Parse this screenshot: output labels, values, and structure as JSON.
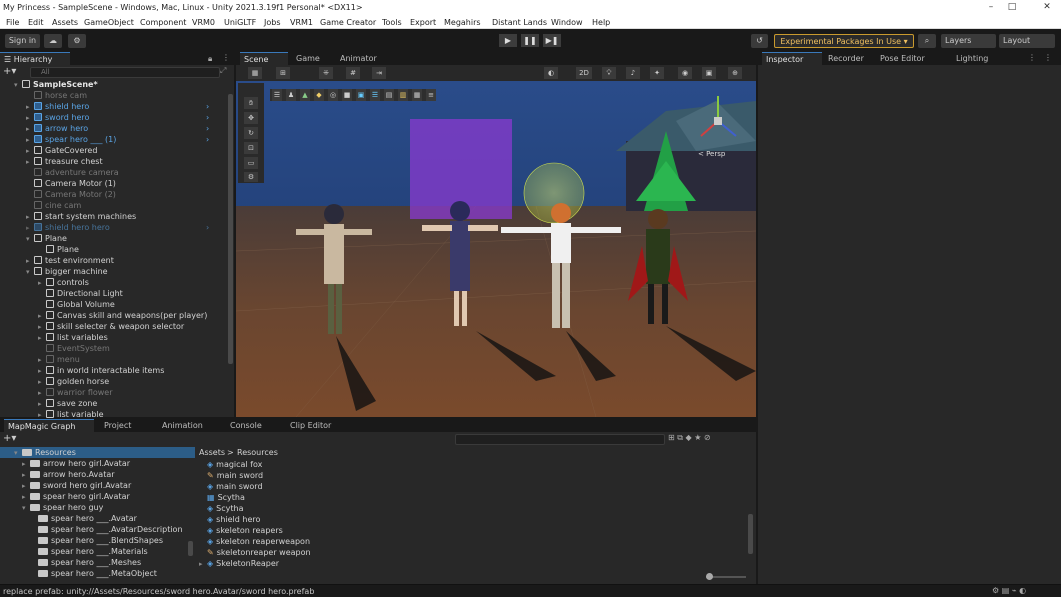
{
  "window": {
    "title": "My Princess - SampleScene - Windows, Mac, Linux - Unity 2021.3.19f1 Personal* <DX11>",
    "minimize": "–",
    "maximize": "□",
    "close": "✕"
  },
  "menu": [
    "File",
    "Edit",
    "Assets",
    "GameObject",
    "Component",
    "VRM0",
    "UniGLTF",
    "Jobs",
    "VRM1",
    "Game Creator",
    "Tools",
    "Export",
    "Megahirs",
    "Distant Lands",
    "Window",
    "Help"
  ],
  "toolbar": {
    "sign_in": "Sign in",
    "play": "▶",
    "pause": "❚❚",
    "step": "▶❚",
    "experimental": "Experimental Packages In Use ▾",
    "layers": "Layers",
    "layout": "Layout"
  },
  "hierarchy": {
    "tab": "Hierarchy",
    "search_placeholder": "All",
    "items": [
      {
        "label": "SampleScene*",
        "style": "scene",
        "indent": 0,
        "arrow": "▾"
      },
      {
        "label": "horse cam",
        "style": "dim",
        "indent": 2,
        "arrow": ""
      },
      {
        "label": "shield hero",
        "style": "blue",
        "indent": 2,
        "arrow": "▸"
      },
      {
        "label": "sword hero",
        "style": "blue",
        "indent": 2,
        "arrow": "▸"
      },
      {
        "label": "arrow hero",
        "style": "blue",
        "indent": 2,
        "arrow": "▸"
      },
      {
        "label": "spear hero ___ (1)",
        "style": "blue",
        "indent": 2,
        "arrow": "▸"
      },
      {
        "label": "GateCovered",
        "style": "normal",
        "indent": 2,
        "arrow": "▸"
      },
      {
        "label": "treasure chest",
        "style": "normal",
        "indent": 2,
        "arrow": "▸"
      },
      {
        "label": "adventure camera",
        "style": "dim",
        "indent": 2,
        "arrow": ""
      },
      {
        "label": "Camera Motor (1)",
        "style": "normal",
        "indent": 2,
        "arrow": ""
      },
      {
        "label": "Camera Motor (2)",
        "style": "dim",
        "indent": 2,
        "arrow": ""
      },
      {
        "label": "cine cam",
        "style": "dim",
        "indent": 2,
        "arrow": ""
      },
      {
        "label": "start system machines",
        "style": "normal",
        "indent": 2,
        "arrow": "▸"
      },
      {
        "label": "shield hero hero",
        "style": "blue-dim",
        "indent": 2,
        "arrow": "▸"
      },
      {
        "label": "Plane",
        "style": "normal",
        "indent": 2,
        "arrow": "▾"
      },
      {
        "label": "Plane",
        "style": "normal",
        "indent": 4,
        "arrow": ""
      },
      {
        "label": "test environment",
        "style": "normal",
        "indent": 2,
        "arrow": "▸"
      },
      {
        "label": "bigger machine",
        "style": "normal",
        "indent": 2,
        "arrow": "▾"
      },
      {
        "label": "controls",
        "style": "normal",
        "indent": 4,
        "arrow": "▸"
      },
      {
        "label": "Directional Light",
        "style": "normal",
        "indent": 4,
        "arrow": ""
      },
      {
        "label": "Global Volume",
        "style": "normal",
        "indent": 4,
        "arrow": ""
      },
      {
        "label": "Canvas skill and weapons(per player)",
        "style": "normal",
        "indent": 4,
        "arrow": "▸"
      },
      {
        "label": "skill selecter & weapon selector",
        "style": "normal",
        "indent": 4,
        "arrow": "▸"
      },
      {
        "label": "list variables",
        "style": "normal",
        "indent": 4,
        "arrow": "▸"
      },
      {
        "label": "EventSystem",
        "style": "dim",
        "indent": 4,
        "arrow": ""
      },
      {
        "label": "menu",
        "style": "dim",
        "indent": 4,
        "arrow": "▸"
      },
      {
        "label": "in world interactable items",
        "style": "normal",
        "indent": 4,
        "arrow": "▸"
      },
      {
        "label": "golden horse",
        "style": "normal",
        "indent": 4,
        "arrow": "▸"
      },
      {
        "label": "warrior flower",
        "style": "dim",
        "indent": 4,
        "arrow": "▸"
      },
      {
        "label": "save zone",
        "style": "normal",
        "indent": 4,
        "arrow": "▸"
      },
      {
        "label": "list variable",
        "style": "normal",
        "indent": 4,
        "arrow": "▸"
      }
    ]
  },
  "scene": {
    "tabs": [
      "Scene",
      "Game",
      "Animator"
    ],
    "mode_2d": "2D",
    "persp": "< Persp"
  },
  "inspector": {
    "tabs": [
      "Inspector",
      "Recorder",
      "Pose Editor",
      "Lighting"
    ]
  },
  "bottom": {
    "tabs": [
      "MapMagic Graph",
      "Project",
      "Animation",
      "Console",
      "Clip Editor"
    ],
    "tree": [
      {
        "label": "Resources",
        "indent": 1,
        "arrow": "▾"
      },
      {
        "label": "arrow hero girl.Avatar",
        "indent": 2,
        "arrow": "▸"
      },
      {
        "label": "arrow hero.Avatar",
        "indent": 2,
        "arrow": "▸"
      },
      {
        "label": "sword hero girl.Avatar",
        "indent": 2,
        "arrow": "▸"
      },
      {
        "label": "spear hero girl.Avatar",
        "indent": 2,
        "arrow": "▸"
      },
      {
        "label": "spear hero guy",
        "indent": 2,
        "arrow": "▾"
      },
      {
        "label": "spear hero ___.Avatar",
        "indent": 3,
        "arrow": ""
      },
      {
        "label": "spear hero ___.AvatarDescription",
        "indent": 3,
        "arrow": ""
      },
      {
        "label": "spear hero ___.BlendShapes",
        "indent": 3,
        "arrow": ""
      },
      {
        "label": "spear hero ___.Materials",
        "indent": 3,
        "arrow": ""
      },
      {
        "label": "spear hero ___.Meshes",
        "indent": 3,
        "arrow": ""
      },
      {
        "label": "spear hero ___.MetaObject",
        "indent": 3,
        "arrow": ""
      }
    ],
    "breadcrumb": [
      "Assets",
      "Resources"
    ],
    "files": [
      {
        "label": "magical fox",
        "icon": "cube"
      },
      {
        "label": "main sword",
        "icon": "pen"
      },
      {
        "label": "main sword",
        "icon": "cube"
      },
      {
        "label": "Scytha",
        "icon": "grid"
      },
      {
        "label": "Scytha",
        "icon": "cube"
      },
      {
        "label": "shield hero",
        "icon": "cube"
      },
      {
        "label": "skeleton reapers",
        "icon": "cube"
      },
      {
        "label": "skeleton reaperweapon",
        "icon": "cube"
      },
      {
        "label": "skeletonreaper weapon",
        "icon": "pen"
      },
      {
        "label": "SkeletonReaper",
        "icon": "cube"
      }
    ]
  },
  "status": {
    "message": "replace prefab: unity://Assets/Resources/sword hero.Avatar/sword hero.prefab"
  }
}
